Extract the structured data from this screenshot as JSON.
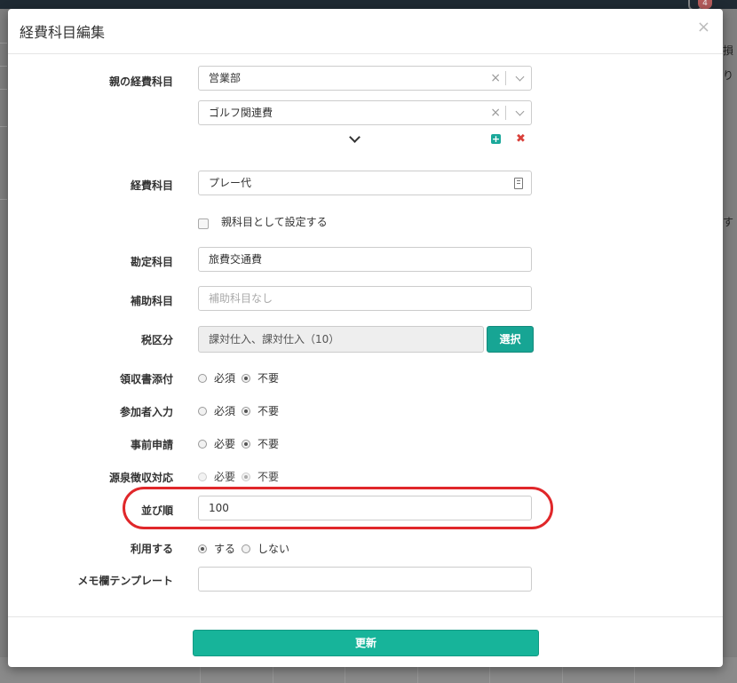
{
  "background": {
    "notification_count": "4",
    "right_texts": [
      "損",
      "り",
      "す"
    ]
  },
  "modal": {
    "title": "経費科目編集",
    "close_glyph": "×"
  },
  "fields": {
    "parent": {
      "label": "親の経費科目",
      "select1": "営業部",
      "select2": "ゴルフ関連費",
      "clear_glyph": "×",
      "add_glyph": "+",
      "remove_glyph": "✖"
    },
    "expense": {
      "label": "経費科目",
      "value": "プレー代"
    },
    "set_as_parent": {
      "label": "親科目として設定する"
    },
    "account": {
      "label": "勘定科目",
      "value": "旅費交通費"
    },
    "sub_account": {
      "label": "補助科目",
      "placeholder": "補助科目なし"
    },
    "tax": {
      "label": "税区分",
      "value": "課対仕入、課対仕入（10）",
      "button": "選択"
    },
    "receipt": {
      "label": "領収書添付",
      "options": [
        "必須",
        "不要"
      ],
      "selected": "不要"
    },
    "attendee": {
      "label": "参加者入力",
      "options": [
        "必須",
        "不要"
      ],
      "selected": "不要"
    },
    "pre_approval": {
      "label": "事前申請",
      "options": [
        "必要",
        "不要"
      ],
      "selected": "不要"
    },
    "withholding": {
      "label": "源泉徴収対応",
      "options": [
        "必要",
        "不要"
      ],
      "selected": "不要"
    },
    "sort_order": {
      "label": "並び順",
      "value": "100"
    },
    "use": {
      "label": "利用する",
      "options": [
        "する",
        "しない"
      ],
      "selected": "する"
    },
    "memo_template": {
      "label": "メモ欄テンプレート",
      "value": ""
    }
  },
  "footer": {
    "submit": "更新"
  },
  "colors": {
    "primary": "#17b49a",
    "highlight": "#e0272a",
    "danger": "#d9403a"
  }
}
